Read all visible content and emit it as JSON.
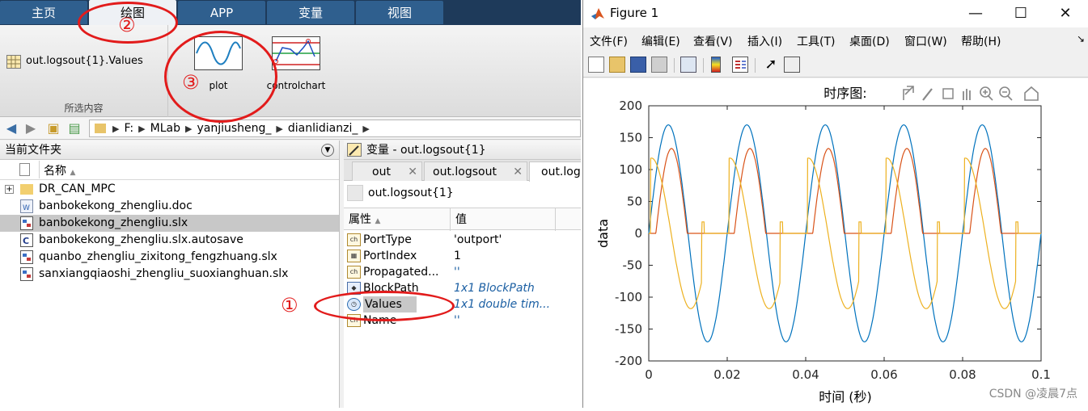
{
  "main_tabs": [
    {
      "label": "主页"
    },
    {
      "label": "绘图"
    },
    {
      "label": "APP"
    },
    {
      "label": "变量"
    },
    {
      "label": "视图"
    }
  ],
  "ribbon": {
    "selection_value": "out.logsout{1}.Values",
    "selection_section_label": "所选内容",
    "gallery": [
      {
        "label": "plot",
        "icon": "sine-plot-icon"
      },
      {
        "label": "controlchart",
        "icon": "control-chart-icon"
      }
    ]
  },
  "address": {
    "crumbs": [
      "F:",
      "MLab",
      "yanjiusheng_",
      "dianlidianzi_"
    ]
  },
  "folder_panel": {
    "title": "当前文件夹",
    "column_name": "名称",
    "files": [
      {
        "name": "DR_CAN_MPC",
        "icon": "folder-icon"
      },
      {
        "name": "banbokekong_zhengliu.doc",
        "icon": "doc-file-icon"
      },
      {
        "name": "banbokekong_zhengliu.slx",
        "icon": "simulink-file-icon"
      },
      {
        "name": "banbokekong_zhengliu.slx.autosave",
        "icon": "autosave-file-icon"
      },
      {
        "name": "quanbo_zhengliu_zixitong_fengzhuang.slx",
        "icon": "simulink-file-icon"
      },
      {
        "name": "sanxiangqiaoshi_zhengliu_suoxianghuan.slx",
        "icon": "simulink-file-icon"
      }
    ]
  },
  "var_panel": {
    "title": "变量 - out.logsout{1}",
    "tabs": [
      {
        "label": "out"
      },
      {
        "label": "out.logsout"
      },
      {
        "label": "out.logs"
      }
    ],
    "path": "out.logsout{1}",
    "col_property": "属性",
    "col_value": "值",
    "rows": [
      {
        "name": "PortType",
        "value": "'outport'"
      },
      {
        "name": "PortIndex",
        "value": "1"
      },
      {
        "name": "Propagated...",
        "value": "''"
      },
      {
        "name": "BlockPath",
        "value": "1x1 BlockPath"
      },
      {
        "name": "Values",
        "value": "1x1 double tim..."
      },
      {
        "name": "Name",
        "value": "''"
      }
    ]
  },
  "annotations": {
    "n1": "①",
    "n2": "②",
    "n3": "③"
  },
  "figure": {
    "title": "Figure 1",
    "menus": [
      "文件(F)",
      "编辑(E)",
      "查看(V)",
      "插入(I)",
      "工具(T)",
      "桌面(D)",
      "窗口(W)",
      "帮助(H)"
    ],
    "watermark": "CSDN @凌晨7点"
  },
  "chart_data": {
    "type": "line",
    "title": "时序图:",
    "xlabel": "时间 (秒)",
    "ylabel": "data",
    "xlim": [
      0,
      0.1
    ],
    "ylim": [
      -200,
      200
    ],
    "xticks": [
      "0",
      "0.02",
      "0.04",
      "0.06",
      "0.08",
      "0.1"
    ],
    "yticks": [
      "200",
      "150",
      "100",
      "50",
      "0",
      "-50",
      "-100",
      "-150",
      "-200"
    ],
    "grid": false,
    "series": [
      {
        "color": "#0072bd",
        "description": "sine amplitude 170, 50 Hz",
        "amplitude": 170,
        "freq_hz": 50
      },
      {
        "color": "#d95319",
        "description": "positive half wave peak 133 from t=0.002 to t=0.01 each period",
        "amplitude": 133
      },
      {
        "color": "#edb120",
        "description": "leading sine amplitude 118 until t=0.0073, then 0 with spikes",
        "amplitude": 118
      }
    ]
  }
}
